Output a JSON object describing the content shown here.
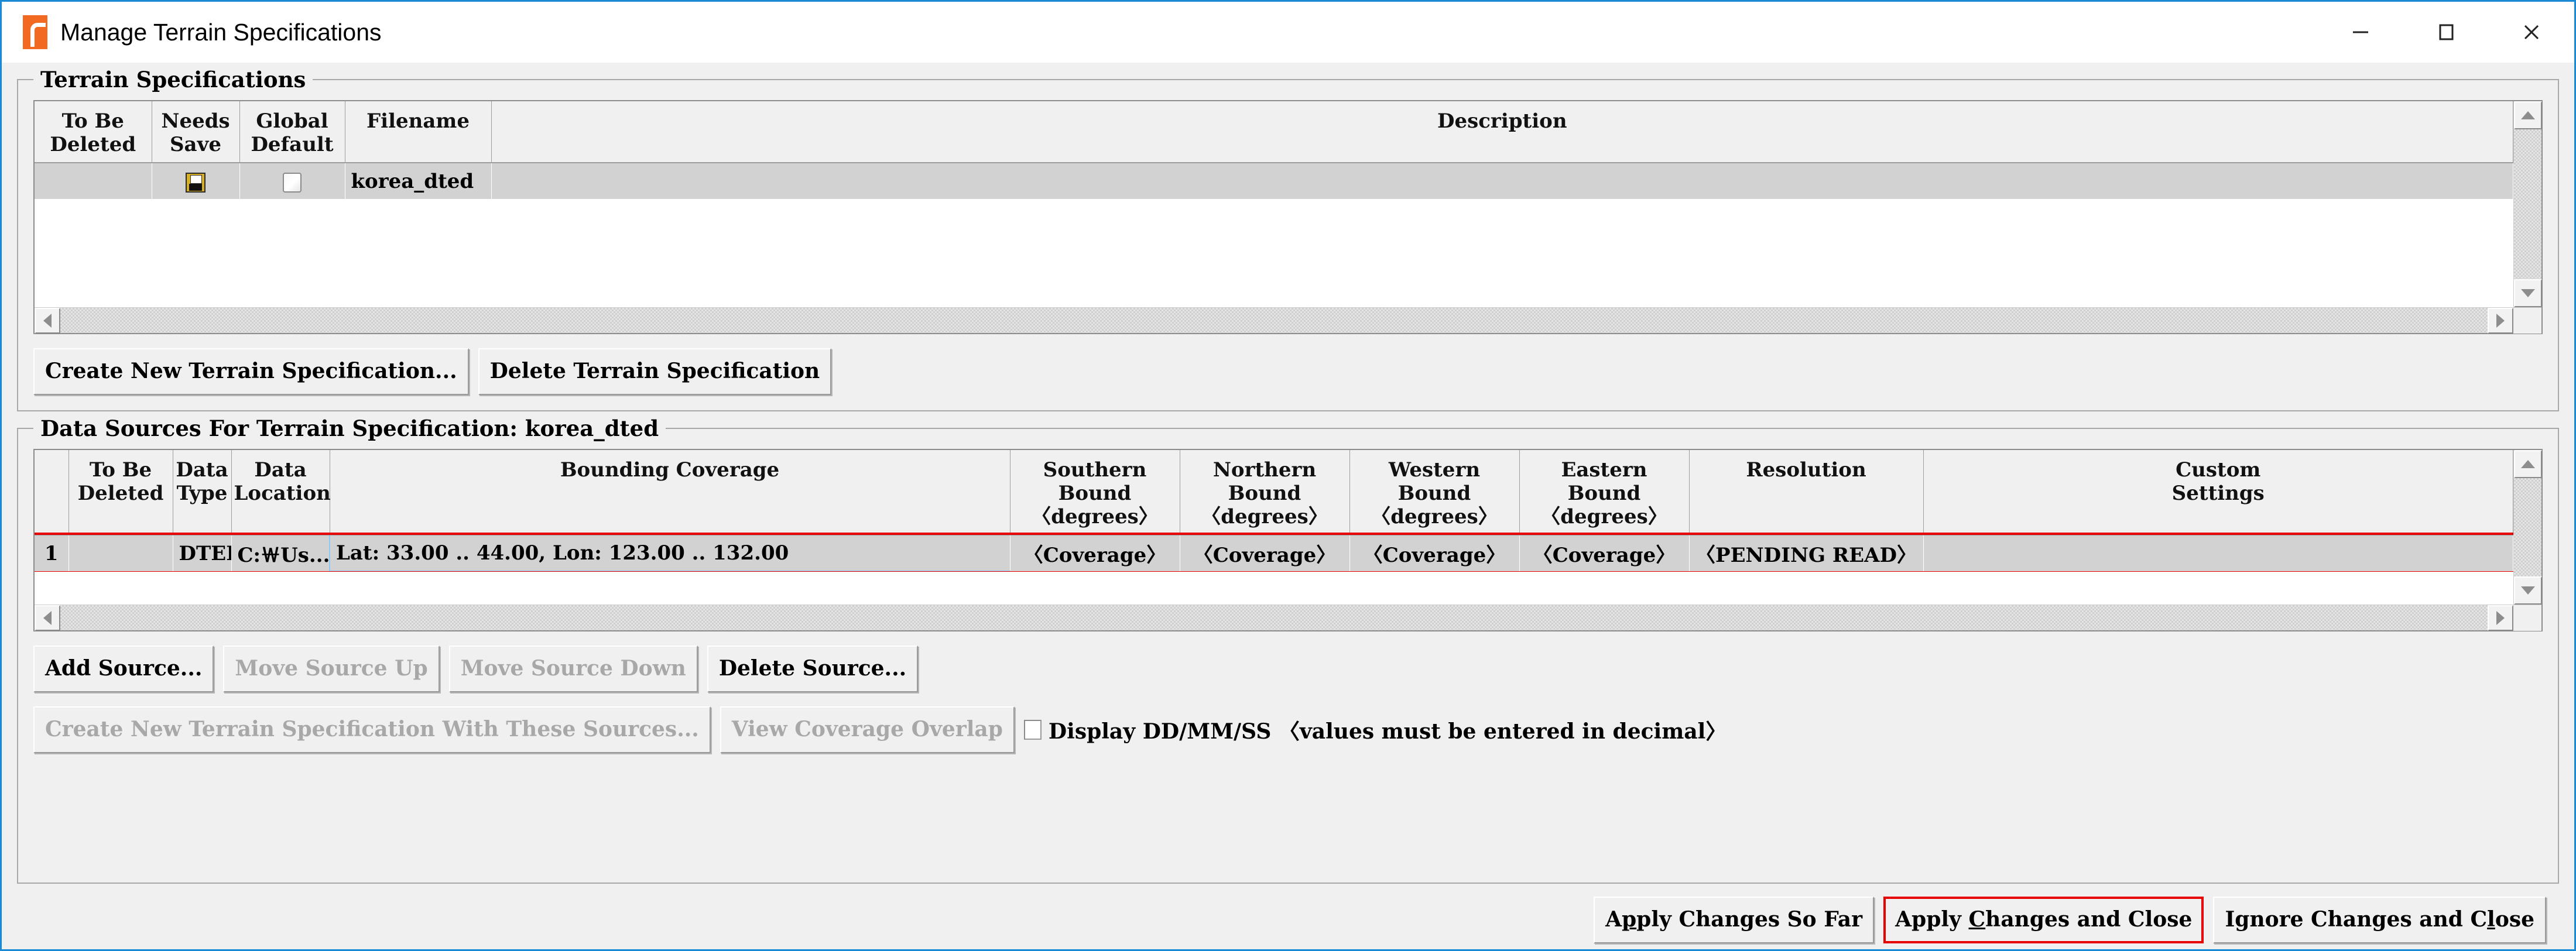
{
  "window": {
    "title": "Manage Terrain Specifications",
    "icon": "app-logo-icon",
    "accent_blue": "#1b8ad6",
    "controls": {
      "minimize": "minimize-icon",
      "maximize": "maximize-icon",
      "close": "close-icon"
    }
  },
  "terrain_spec_group": {
    "title": "Terrain Specifications",
    "columns": [
      "To Be\nDeleted",
      "Needs\nSave",
      "Global\nDefault",
      "Filename",
      "Description"
    ],
    "rows": [
      {
        "to_be_deleted": "",
        "needs_save_icon": "floppy-disk-icon",
        "global_default_checked": false,
        "filename": "korea_dted",
        "description": ""
      }
    ],
    "buttons": [
      {
        "label": "Create New Terrain Specification...",
        "enabled": true
      },
      {
        "label": "Delete Terrain Specification",
        "enabled": true
      }
    ]
  },
  "data_sources_group": {
    "title": "Data Sources For Terrain Specification: korea_dted",
    "columns": [
      "",
      "To Be\nDeleted",
      "Data\nType",
      "Data\nLocation",
      "Bounding Coverage",
      "Southern\nBound\n〈degrees〉",
      "Northern\nBound\n〈degrees〉",
      "Western\nBound\n〈degrees〉",
      "Eastern\nBound\n〈degrees〉",
      "Resolution",
      "Custom\nSettings"
    ],
    "rows": [
      {
        "index": "1",
        "to_be_deleted": "",
        "data_type": "DTED",
        "data_location": "C:￦Us...",
        "bounding_coverage": "Lat: 33.00 .. 44.00, Lon: 123.00 .. 132.00",
        "southern_bound": "〈Coverage〉",
        "northern_bound": "〈Coverage〉",
        "western_bound": "〈Coverage〉",
        "eastern_bound": "〈Coverage〉",
        "resolution": "〈PENDING READ〉",
        "custom_settings": "",
        "selected_cell": "bounding_coverage",
        "row_focus_outline": "#e60000"
      }
    ],
    "buttons": [
      {
        "label": "Add Source...",
        "enabled": true
      },
      {
        "label": "Move Source Up",
        "enabled": false
      },
      {
        "label": "Move Source Down",
        "enabled": false
      },
      {
        "label": "Delete Source...",
        "enabled": true
      }
    ],
    "buttons_secondary": [
      {
        "label": "Create New Terrain Specification With These Sources...",
        "enabled": false
      },
      {
        "label": "View Coverage Overlap",
        "enabled": false
      }
    ],
    "display_option": {
      "label": "Display DD/MM/SS 〈values must be entered in decimal〉",
      "checked": false
    }
  },
  "dialog_buttons": [
    {
      "id": "apply-so-far",
      "pre": "A",
      "mnemonic": "p",
      "post": "ply Changes So Far",
      "focused": false
    },
    {
      "id": "apply-close",
      "pre": "Apply ",
      "mnemonic": "C",
      "post": "hanges and Close",
      "focused": true
    },
    {
      "id": "ignore-close",
      "pre": "Ignore Changes and C",
      "mnemonic": "l",
      "post": "ose",
      "focused": false
    }
  ]
}
